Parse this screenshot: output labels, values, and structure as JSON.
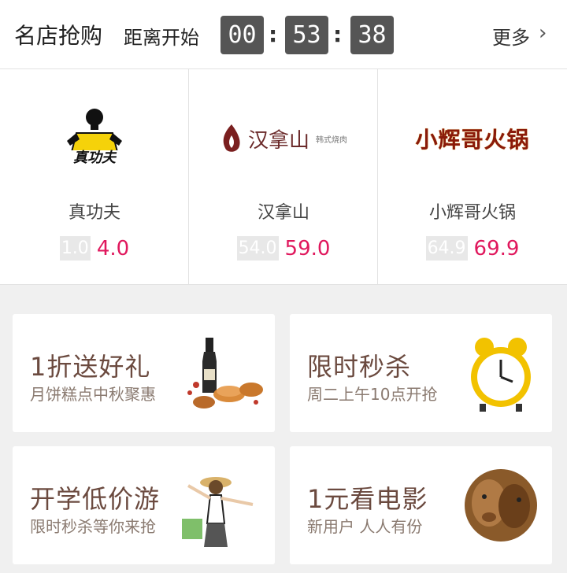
{
  "header": {
    "title": "名店抢购",
    "countdown_label": "距离开始",
    "countdown": {
      "hours": "00",
      "minutes": "53",
      "seconds": "38",
      "separator": ":"
    },
    "more_label": "更多",
    "chevron": "›"
  },
  "shops": [
    {
      "name": "真功夫",
      "old_price": "1.0",
      "new_price": "4.0",
      "logo_text": "真功夫"
    },
    {
      "name": "汉拿山",
      "old_price": "54.0",
      "new_price": "59.0",
      "logo_text": "汉拿山",
      "logo_small": "韩式烧肉"
    },
    {
      "name": "小辉哥火锅",
      "old_price": "64.9",
      "new_price": "69.9",
      "logo_text": "小辉哥火锅"
    }
  ],
  "promos": [
    {
      "title": "1折送好礼",
      "subtitle": "月饼糕点中秋聚惠",
      "icon": "mooncake-wine-icon"
    },
    {
      "title": "限时秒杀",
      "subtitle": "周二上午10点开抢",
      "icon": "alarm-clock-icon"
    },
    {
      "title": "开学低价游",
      "subtitle": "限时秒杀等你来抢",
      "icon": "traveler-girl-icon"
    },
    {
      "title": "1元看电影",
      "subtitle": "新用户 人人有份",
      "icon": "movie-apes-icon"
    }
  ],
  "colors": {
    "accent": "#e0185d",
    "countdown_bg": "#555555",
    "promo_title": "#6b4a3f"
  }
}
